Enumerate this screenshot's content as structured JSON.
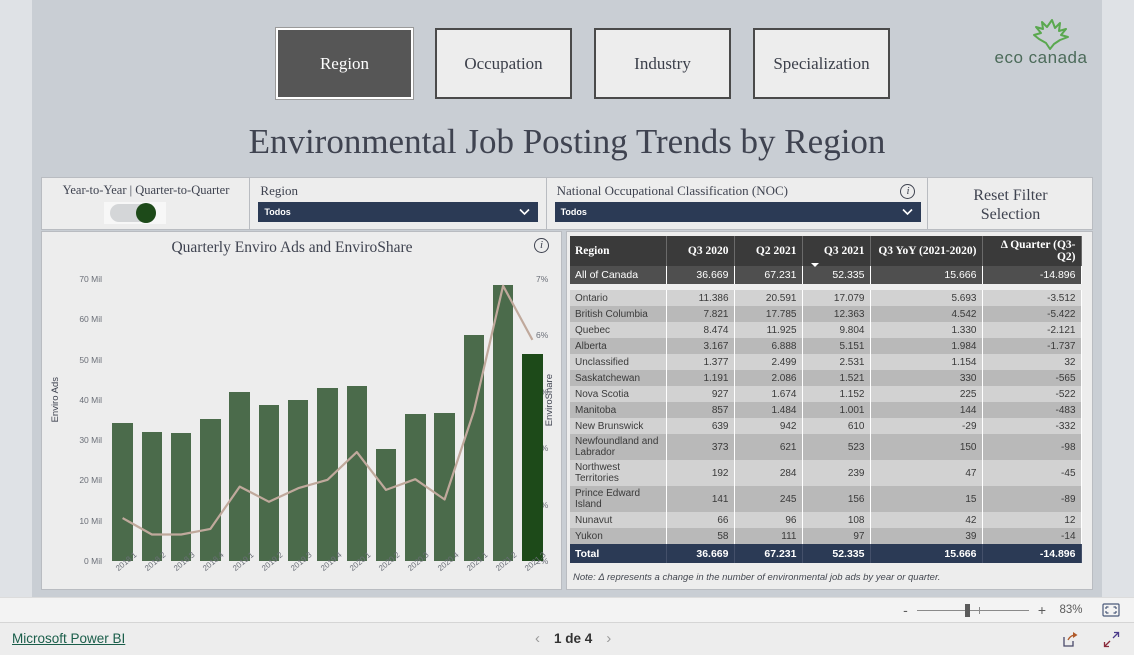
{
  "nav": {
    "buttons": [
      {
        "label": "Region",
        "active": true
      },
      {
        "label": "Occupation",
        "active": false
      },
      {
        "label": "Industry",
        "active": false
      },
      {
        "label": "Specialization",
        "active": false
      }
    ]
  },
  "brand": {
    "name": "eco canada",
    "logo_icon": "maple-leaf-icon",
    "color": "#5aa84f"
  },
  "page": {
    "title": "Environmental Job Posting Trends by Region"
  },
  "filters": {
    "toggle": {
      "label": "Year-to-Year | Quarter-to-Quarter",
      "state": "on"
    },
    "region": {
      "label": "Region",
      "value": "Todos"
    },
    "noc": {
      "label": "National Occupational Classification (NOC)",
      "value": "Todos",
      "info_icon": "info-icon"
    },
    "reset": {
      "line1": "Reset Filter",
      "line2": "Selection"
    }
  },
  "chart_data": {
    "type": "bar",
    "title": "Quarterly Enviro Ads and EnviroShare",
    "xlabel": "",
    "ylabel": "Enviro Ads",
    "y2label": "EnviroShare",
    "ylim": [
      0,
      70
    ],
    "y2lim": [
      2,
      7
    ],
    "grid": false,
    "legend": "none",
    "yticks": [
      "0 Mil",
      "10 Mil",
      "20 Mil",
      "30 Mil",
      "40 Mil",
      "50 Mil",
      "60 Mil",
      "70 Mil"
    ],
    "y2ticks": [
      "2%",
      "3%",
      "4%",
      "5%",
      "6%",
      "7%"
    ],
    "categories": [
      "2018.1",
      "2018.2",
      "2018.3",
      "2018.4",
      "2019.1",
      "2019.2",
      "2019.3",
      "2019.4",
      "2020.1",
      "2020.2",
      "2020.3",
      "2020.4",
      "2021.1",
      "2021.2",
      "2021.3"
    ],
    "series": [
      {
        "name": "Enviro Ads",
        "type": "bar",
        "unit": "Mil",
        "color": "#4b6b4b",
        "highlight_color": "#1d4a19",
        "highlight_index": 14,
        "values": [
          34.3,
          31.9,
          31.8,
          35.2,
          41.9,
          38.7,
          39.9,
          43.0,
          43.4,
          27.9,
          36.5,
          36.8,
          56.0,
          68.5,
          51.5
        ]
      },
      {
        "name": "EnviroShare",
        "type": "line",
        "unit": "%",
        "color": "#c0a99c",
        "values": [
          2.76,
          2.47,
          2.47,
          2.57,
          3.32,
          3.05,
          3.29,
          3.44,
          3.93,
          3.26,
          3.45,
          3.09,
          4.65,
          6.88,
          5.92
        ]
      }
    ],
    "info_icon": "info-icon"
  },
  "table": {
    "columns": [
      "Region",
      "Q3 2020",
      "Q2 2021",
      "Q3 2021",
      "Q3 YoY (2021-2020)",
      "Δ Quarter (Q3-Q2)"
    ],
    "sorted_column_index": 3,
    "canada_row": [
      "All of Canada",
      "36.669",
      "67.231",
      "52.335",
      "15.666",
      "-14.896"
    ],
    "rows": [
      [
        "Ontario",
        "11.386",
        "20.591",
        "17.079",
        "5.693",
        "-3.512"
      ],
      [
        "British Columbia",
        "7.821",
        "17.785",
        "12.363",
        "4.542",
        "-5.422"
      ],
      [
        "Quebec",
        "8.474",
        "11.925",
        "9.804",
        "1.330",
        "-2.121"
      ],
      [
        "Alberta",
        "3.167",
        "6.888",
        "5.151",
        "1.984",
        "-1.737"
      ],
      [
        "Unclassified",
        "1.377",
        "2.499",
        "2.531",
        "1.154",
        "32"
      ],
      [
        "Saskatchewan",
        "1.191",
        "2.086",
        "1.521",
        "330",
        "-565"
      ],
      [
        "Nova Scotia",
        "927",
        "1.674",
        "1.152",
        "225",
        "-522"
      ],
      [
        "Manitoba",
        "857",
        "1.484",
        "1.001",
        "144",
        "-483"
      ],
      [
        "New Brunswick",
        "639",
        "942",
        "610",
        "-29",
        "-332"
      ],
      [
        "Newfoundland and Labrador",
        "373",
        "621",
        "523",
        "150",
        "-98"
      ],
      [
        "Northwest Territories",
        "192",
        "284",
        "239",
        "47",
        "-45"
      ],
      [
        "Prince Edward Island",
        "141",
        "245",
        "156",
        "15",
        "-89"
      ],
      [
        "Nunavut",
        "66",
        "96",
        "108",
        "42",
        "12"
      ],
      [
        "Yukon",
        "58",
        "111",
        "97",
        "39",
        "-14"
      ]
    ],
    "total_row": [
      "Total",
      "36.669",
      "67.231",
      "52.335",
      "15.666",
      "-14.896"
    ],
    "note": "Note: Δ represents a change in the number of environmental job ads by year or quarter."
  },
  "statusbar": {
    "zoom_out": "-",
    "zoom_in": "+",
    "zoom_level": "83%",
    "fit_icon": "fit-to-screen-icon"
  },
  "footer": {
    "brand_link": "Microsoft Power BI",
    "prev_icon": "chevron-left-icon",
    "next_icon": "chevron-right-icon",
    "page_label": "1 de 4",
    "share_icon": "share-icon",
    "fullscreen_icon": "fullscreen-icon"
  }
}
